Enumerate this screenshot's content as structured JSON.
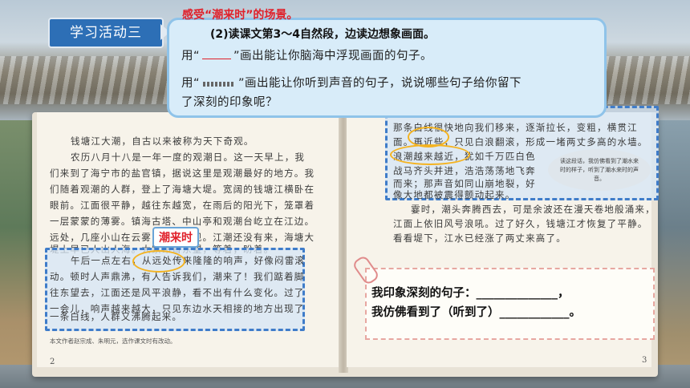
{
  "activity": {
    "label": "学习活动三"
  },
  "task": {
    "title": "感受“潮来时”的场景。",
    "subtitle": "(2)读课文第3～4自然段，边读边想象画面。",
    "line1_prefix": "用“",
    "line1_suffix": "”画出能让你脑海中浮现画面的句子。",
    "line2_prefix": "用“",
    "line2_suffix": "”画出能让你听到声音的句子，说说哪些句子给你留下",
    "line3": "了深刻的印象呢？"
  },
  "left_page": {
    "paragraphs": [
      "钱塘江大潮，自古以来被称为天下奇观。",
      "农历八月十八是一年一度的观潮日。这一天早上，我",
      "们来到了海宁市的盐官镇，据说这里是观潮最好的地方。我",
      "们随着观潮的人群，登上了海塘大堤。宽阔的钱塘江横卧在",
      "眼前。江面很平静，越往东越宽，在雨后的阳光下，笼罩着",
      "一层蒙蒙的薄雾。镇海古塔、中山亭和观潮台屹立在江边。",
      "远处，几座小山在云雾中若隐若现。江潮还没有来，海塘大",
      "堤上早已人山人海。大家昂首东望，等着，盼着。",
      "午后一点左右，从远处传来隆隆的响声，好像闷雷滚",
      "动。顿时人声鼎沸，有人告诉我们，潮来了！我们踮着脚",
      "往东望去，江面还是风平浪静，看不出有什么变化。过了",
      "一会儿，响声越来越大，只见东边水天相接的地方出现了",
      "一条白线，人群又沸腾起来。"
    ],
    "footnote": "本文作者赵宗成、朱明元，选作课文时有改动。",
    "page_number": "2"
  },
  "right_page": {
    "paragraphs": [
      "那条白线很快地向我们移来，逐渐拉长，变粗，横贯江",
      "面。再近些，只见白浪翻滚，形成一堵两丈多高的水墙。",
      "浪潮越来越近，犹如千万匹白色",
      "战马齐头并进，浩浩荡荡地飞奔",
      "而来；那声音如同山崩地裂，好",
      "像大地都被震得颤动起来。",
      "霎时，潮头奔腾西去，可是余波还在漫天卷地般涌来，",
      "江面上依旧风号浪吼。过了好久，钱塘江才恢复了平静。",
      "看看堤下，江水已经涨了两丈来高了。"
    ],
    "bubble_text": "读这段话，我仿佛看到了潮水来时的样子，听到了潮水来时的声音。",
    "page_number": "3"
  },
  "label_chaolaishi": "潮来时",
  "note": {
    "line1": "我印象深刻的句子：______________，",
    "line2": "我仿佛看到了（听到了）____________。"
  }
}
